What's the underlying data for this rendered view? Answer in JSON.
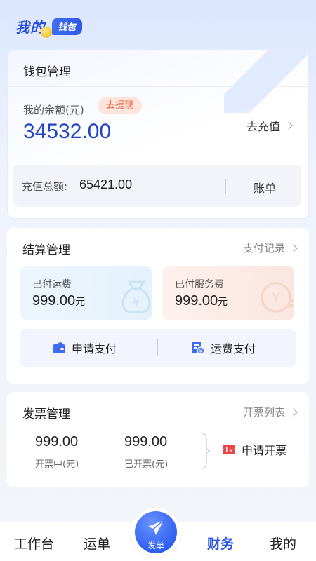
{
  "header": {
    "title": "我的",
    "badge": "钱包"
  },
  "wallet": {
    "title": "钱包管理",
    "balance_label": "我的余额(元)",
    "withdraw_label": "去提现",
    "balance_value": "34532.00",
    "recharge_label": "去充值",
    "total_label": "充值总额:",
    "total_value": "65421.00",
    "bill_label": "账单"
  },
  "settlement": {
    "title": "结算管理",
    "records_label": "支付记录",
    "freight_paid_label": "已付运费",
    "freight_paid_value": "999.00",
    "service_paid_label": "已付服务费",
    "service_paid_value": "999.00",
    "unit": "元",
    "apply_pay_label": "申请支付",
    "freight_pay_label": "运费支付"
  },
  "invoice": {
    "title": "发票管理",
    "list_label": "开票列表",
    "in_progress_value": "999.00",
    "in_progress_label": "开票中(元)",
    "issued_value": "999.00",
    "issued_label": "已开票(元)",
    "apply_label": "申请开票"
  },
  "tabbar": {
    "workbench": "工作台",
    "waybill": "运单",
    "dispatch": "发单",
    "finance": "财务",
    "mine": "我的"
  },
  "colors": {
    "accent": "#2d55e4",
    "warning": "#f25a35"
  }
}
